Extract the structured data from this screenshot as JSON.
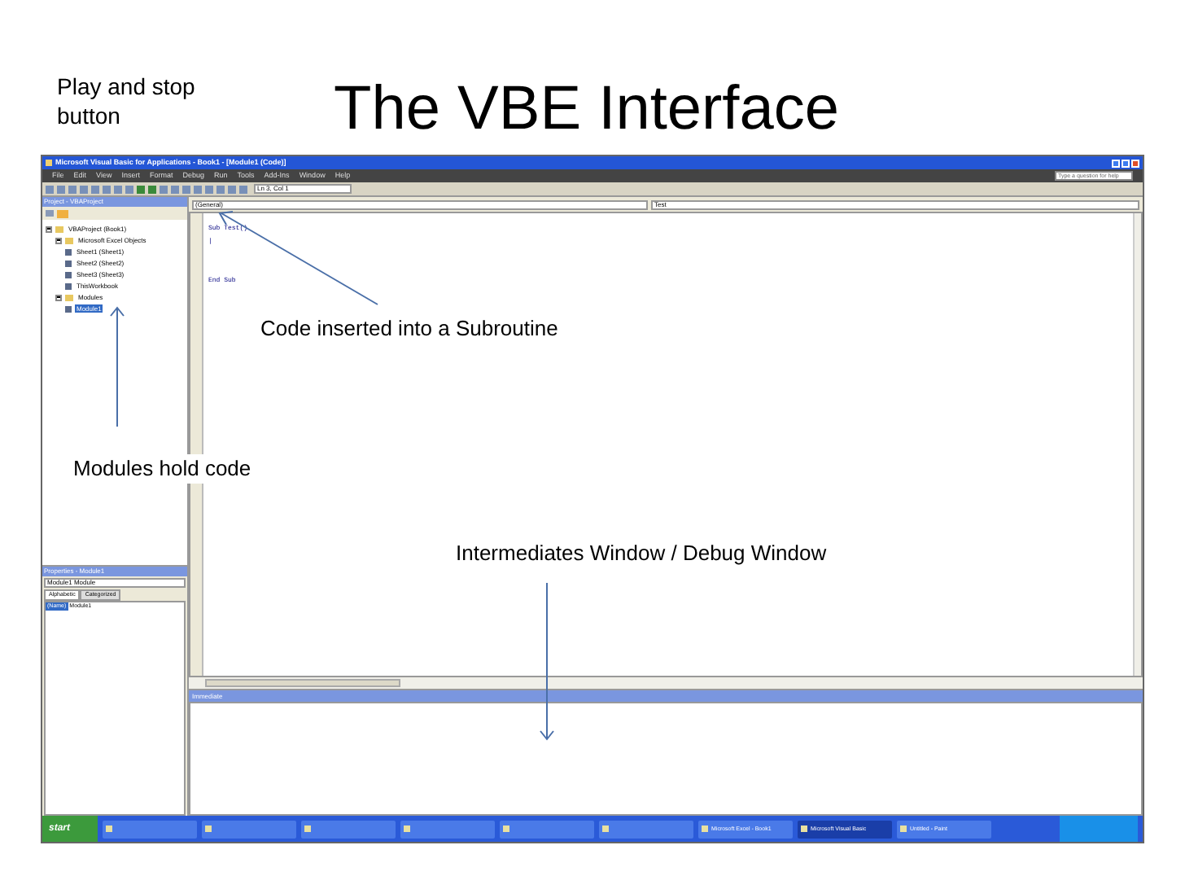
{
  "slide": {
    "title": "The VBE Interface",
    "corner_note": "Play and stop button"
  },
  "annotations": [
    {
      "text": "Code inserted into a Subroutine"
    },
    {
      "text": "Modules hold code"
    },
    {
      "text": "Intermediates Window / Debug Window"
    }
  ],
  "window": {
    "title": "Microsoft Visual Basic for Applications - Book1 - [Module1 (Code)]",
    "help_placeholder": "Type a question for help"
  },
  "menu": [
    "File",
    "Edit",
    "View",
    "Insert",
    "Format",
    "Debug",
    "Run",
    "Tools",
    "Add-Ins",
    "Window",
    "Help"
  ],
  "toolbar": {
    "position": "Ln 3, Col 1"
  },
  "project": {
    "title": "Project - VBAProject",
    "tree": [
      {
        "label": "VBAProject (Book1)",
        "expanded": true,
        "selected": false,
        "children": [
          {
            "label": "Microsoft Excel Objects",
            "expanded": true,
            "selected": false,
            "children": [
              {
                "label": "Sheet1 (Sheet1)",
                "selected": false
              },
              {
                "label": "Sheet2 (Sheet2)",
                "selected": false
              },
              {
                "label": "Sheet3 (Sheet3)",
                "selected": false
              },
              {
                "label": "ThisWorkbook",
                "selected": false
              }
            ]
          },
          {
            "label": "Modules",
            "expanded": true,
            "selected": false,
            "children": [
              {
                "label": "Module1",
                "selected": true
              }
            ]
          }
        ]
      }
    ]
  },
  "properties": {
    "title": "Properties - Module1",
    "object": "Module1 Module",
    "tabs": [
      {
        "label": "Alphabetic",
        "selected": true
      },
      {
        "label": "Categorized",
        "selected": false
      }
    ],
    "rows": [
      {
        "name": "(Name)",
        "value": "Module1"
      }
    ]
  },
  "code": {
    "object": "(General)",
    "procedure": "Test",
    "lines": [
      "Sub Test()",
      "|",
      "End Sub"
    ]
  },
  "immediate": {
    "title": "Immediate"
  },
  "taskbar": {
    "start": "start",
    "items": [
      {
        "selected": false
      },
      {
        "selected": false
      },
      {
        "selected": false
      },
      {
        "selected": false
      },
      {
        "selected": false
      },
      {
        "selected": false
      },
      {
        "label": "Microsoft Excel - Book1",
        "selected": false
      },
      {
        "label": "Microsoft Visual Basic",
        "selected": true
      },
      {
        "label": "Untitled - Paint",
        "selected": false
      }
    ]
  }
}
